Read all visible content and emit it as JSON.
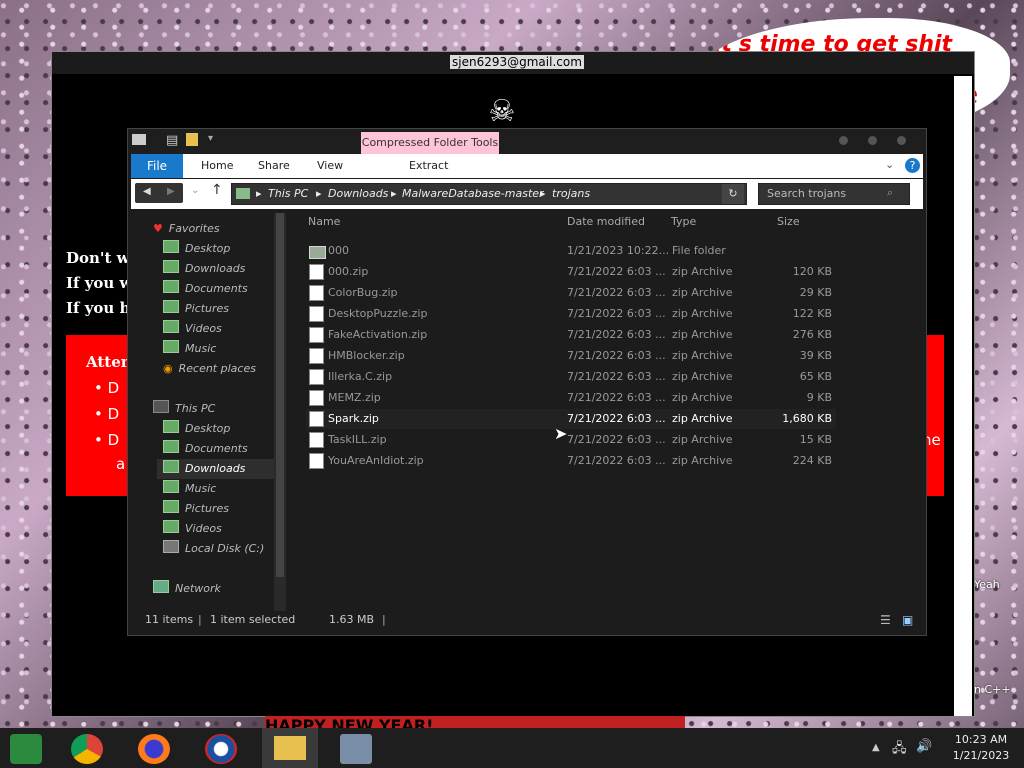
{
  "desktop": {
    "speech_text": "it's time to get shit",
    "speech_text2": "te",
    "icon_label_1": "Yeah",
    "icon_label_2": "n C++"
  },
  "remote": {
    "email": "sjen6293@gmail.com",
    "line1": "Don't wo",
    "line2": "If you w",
    "line3": "If you ha",
    "alert_title": "Atten",
    "bullet1": "D",
    "bullet2": "D",
    "bullet3": "D",
    "bullet3_wrap": "a",
    "bullet3_end": "he",
    "banner": "HAPPY NEW YEAR!"
  },
  "explorer": {
    "compressed_tools": "Compressed Folder Tools",
    "tabs": {
      "file": "File",
      "home": "Home",
      "share": "Share",
      "view": "View",
      "extract": "Extract"
    },
    "breadcrumb": [
      "This PC",
      "Downloads",
      "MalwareDatabase-master",
      "trojans"
    ],
    "search_placeholder": "Search trojans",
    "nav": {
      "favorites": "Favorites",
      "fav_items": [
        "Desktop",
        "Downloads",
        "Documents",
        "Pictures",
        "Videos",
        "Music",
        "Recent places"
      ],
      "thispc": "This PC",
      "pc_items": [
        "Desktop",
        "Documents",
        "Downloads",
        "Music",
        "Pictures",
        "Videos",
        "Local Disk (C:)"
      ],
      "network": "Network"
    },
    "columns": {
      "name": "Name",
      "date": "Date modified",
      "type": "Type",
      "size": "Size"
    },
    "files": [
      {
        "name": "000",
        "date": "1/21/2023 10:22...",
        "type": "File folder",
        "size": ""
      },
      {
        "name": "000.zip",
        "date": "7/21/2022 6:03 ...",
        "type": "zip Archive",
        "size": "120 KB"
      },
      {
        "name": "ColorBug.zip",
        "date": "7/21/2022 6:03 ...",
        "type": "zip Archive",
        "size": "29 KB"
      },
      {
        "name": "DesktopPuzzle.zip",
        "date": "7/21/2022 6:03 ...",
        "type": "zip Archive",
        "size": "122 KB"
      },
      {
        "name": "FakeActivation.zip",
        "date": "7/21/2022 6:03 ...",
        "type": "zip Archive",
        "size": "276 KB"
      },
      {
        "name": "HMBlocker.zip",
        "date": "7/21/2022 6:03 ...",
        "type": "zip Archive",
        "size": "39 KB"
      },
      {
        "name": "Illerka.C.zip",
        "date": "7/21/2022 6:03 ...",
        "type": "zip Archive",
        "size": "65 KB"
      },
      {
        "name": "MEMZ.zip",
        "date": "7/21/2022 6:03 ...",
        "type": "zip Archive",
        "size": "9 KB"
      },
      {
        "name": "Spark.zip",
        "date": "7/21/2022 6:03 ...",
        "type": "zip Archive",
        "size": "1,680 KB"
      },
      {
        "name": "TaskILL.zip",
        "date": "7/21/2022 6:03 ...",
        "type": "zip Archive",
        "size": "15 KB"
      },
      {
        "name": "YouAreAnIdiot.zip",
        "date": "7/21/2022 6:03 ...",
        "type": "zip Archive",
        "size": "224 KB"
      }
    ],
    "selected_index": 8,
    "status": {
      "items": "11 items",
      "selected": "1 item selected",
      "size": "1.63 MB"
    }
  },
  "taskbar": {
    "time": "10:23 AM",
    "date": "1/21/2023"
  }
}
